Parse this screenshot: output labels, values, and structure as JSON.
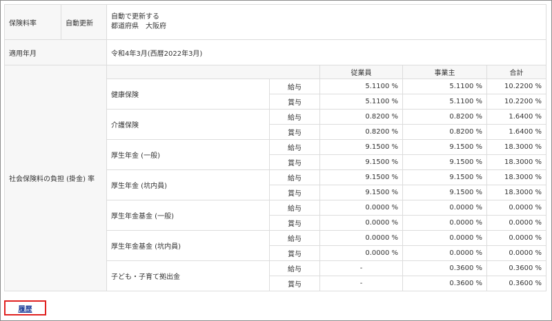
{
  "insurance_rate": {
    "label": "保険料率",
    "auto_update_label": "自動更新",
    "auto_update_value": "自動で更新する",
    "prefecture_value": "都道府県　大阪府"
  },
  "applicable_month": {
    "label": "適用年月",
    "value": "令和4年3月(西暦2022年3月)"
  },
  "burden_rates": {
    "label": "社会保険料の負担 (掛金) 率",
    "headers": {
      "employee": "従業員",
      "employer": "事業主",
      "total": "合計"
    },
    "groups": [
      {
        "name": "健康保険",
        "rows": [
          {
            "type": "給与",
            "employee": "5.1100 %",
            "employer": "5.1100 %",
            "total": "10.2200 %"
          },
          {
            "type": "賞与",
            "employee": "5.1100 %",
            "employer": "5.1100 %",
            "total": "10.2200 %"
          }
        ]
      },
      {
        "name": "介護保険",
        "rows": [
          {
            "type": "給与",
            "employee": "0.8200 %",
            "employer": "0.8200 %",
            "total": "1.6400 %"
          },
          {
            "type": "賞与",
            "employee": "0.8200 %",
            "employer": "0.8200 %",
            "total": "1.6400 %"
          }
        ]
      },
      {
        "name": "厚生年金 (一般)",
        "rows": [
          {
            "type": "給与",
            "employee": "9.1500 %",
            "employer": "9.1500 %",
            "total": "18.3000 %"
          },
          {
            "type": "賞与",
            "employee": "9.1500 %",
            "employer": "9.1500 %",
            "total": "18.3000 %"
          }
        ]
      },
      {
        "name": "厚生年金 (坑内員)",
        "rows": [
          {
            "type": "給与",
            "employee": "9.1500 %",
            "employer": "9.1500 %",
            "total": "18.3000 %"
          },
          {
            "type": "賞与",
            "employee": "9.1500 %",
            "employer": "9.1500 %",
            "total": "18.3000 %"
          }
        ]
      },
      {
        "name": "厚生年金基金 (一般)",
        "rows": [
          {
            "type": "給与",
            "employee": "0.0000 %",
            "employer": "0.0000 %",
            "total": "0.0000 %"
          },
          {
            "type": "賞与",
            "employee": "0.0000 %",
            "employer": "0.0000 %",
            "total": "0.0000 %"
          }
        ]
      },
      {
        "name": "厚生年金基金 (坑内員)",
        "rows": [
          {
            "type": "給与",
            "employee": "0.0000 %",
            "employer": "0.0000 %",
            "total": "0.0000 %"
          },
          {
            "type": "賞与",
            "employee": "0.0000 %",
            "employer": "0.0000 %",
            "total": "0.0000 %"
          }
        ]
      },
      {
        "name": "子ども・子育て拠出金",
        "rows": [
          {
            "type": "給与",
            "employee": "-",
            "employer": "0.3600 %",
            "total": "0.3600 %"
          },
          {
            "type": "賞与",
            "employee": "-",
            "employer": "0.3600 %",
            "total": "0.3600 %"
          }
        ]
      }
    ]
  },
  "history_button": {
    "label": "履歴"
  },
  "colors": {
    "highlight_border": "#e0201f",
    "link": "#1f3f9a",
    "label_bg": "#f7f7f7",
    "grid": "#dcdcdc"
  }
}
